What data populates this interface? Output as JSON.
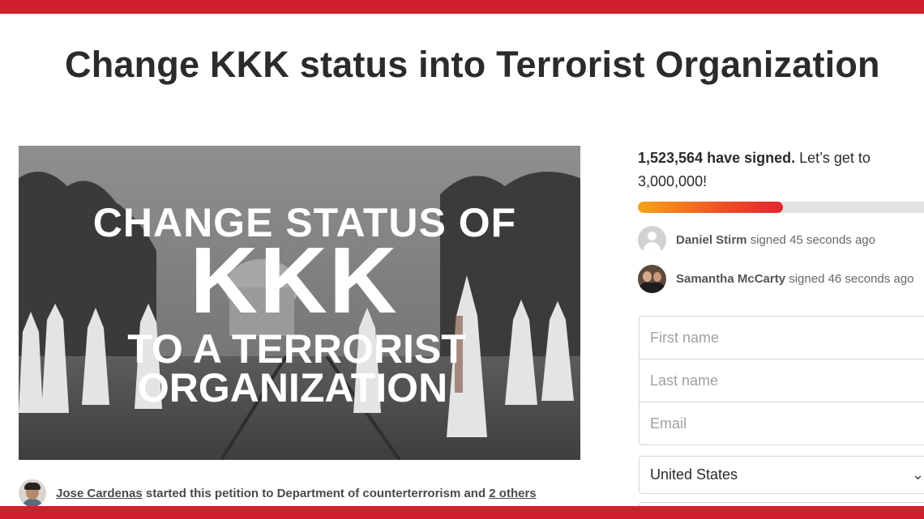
{
  "petition": {
    "title": "Change KKK status into Terrorist Organization",
    "image_text": {
      "line1": "CHANGE STATUS OF",
      "line2": "KKK",
      "line3": "TO A TERRORIST",
      "line4": "ORGANIZATION"
    },
    "creator": {
      "name": "Jose Cardenas",
      "action_text": " started this petition to Department of counterterrorism and ",
      "others_link": "2 others"
    }
  },
  "signatures": {
    "count_text": "1,523,564 have signed.",
    "goal_text": " Let’s get to 3,000,000!",
    "progress_fraction": 0.508
  },
  "recent_signers": [
    {
      "name": "Daniel Stirm",
      "time_text": " signed 45 seconds ago",
      "avatar": "default-avatar-icon"
    },
    {
      "name": "Samantha McCarty",
      "time_text": " signed 46 seconds ago",
      "avatar": "photo-avatar"
    }
  ],
  "form": {
    "first_name_placeholder": "First name",
    "last_name_placeholder": "Last name",
    "email_placeholder": "Email",
    "country_value": "United States",
    "country_chevron": "chevron-down-icon"
  },
  "colors": {
    "brand_red": "#d0202e",
    "progress_start": "#f7a21b",
    "progress_end": "#e2252f"
  }
}
